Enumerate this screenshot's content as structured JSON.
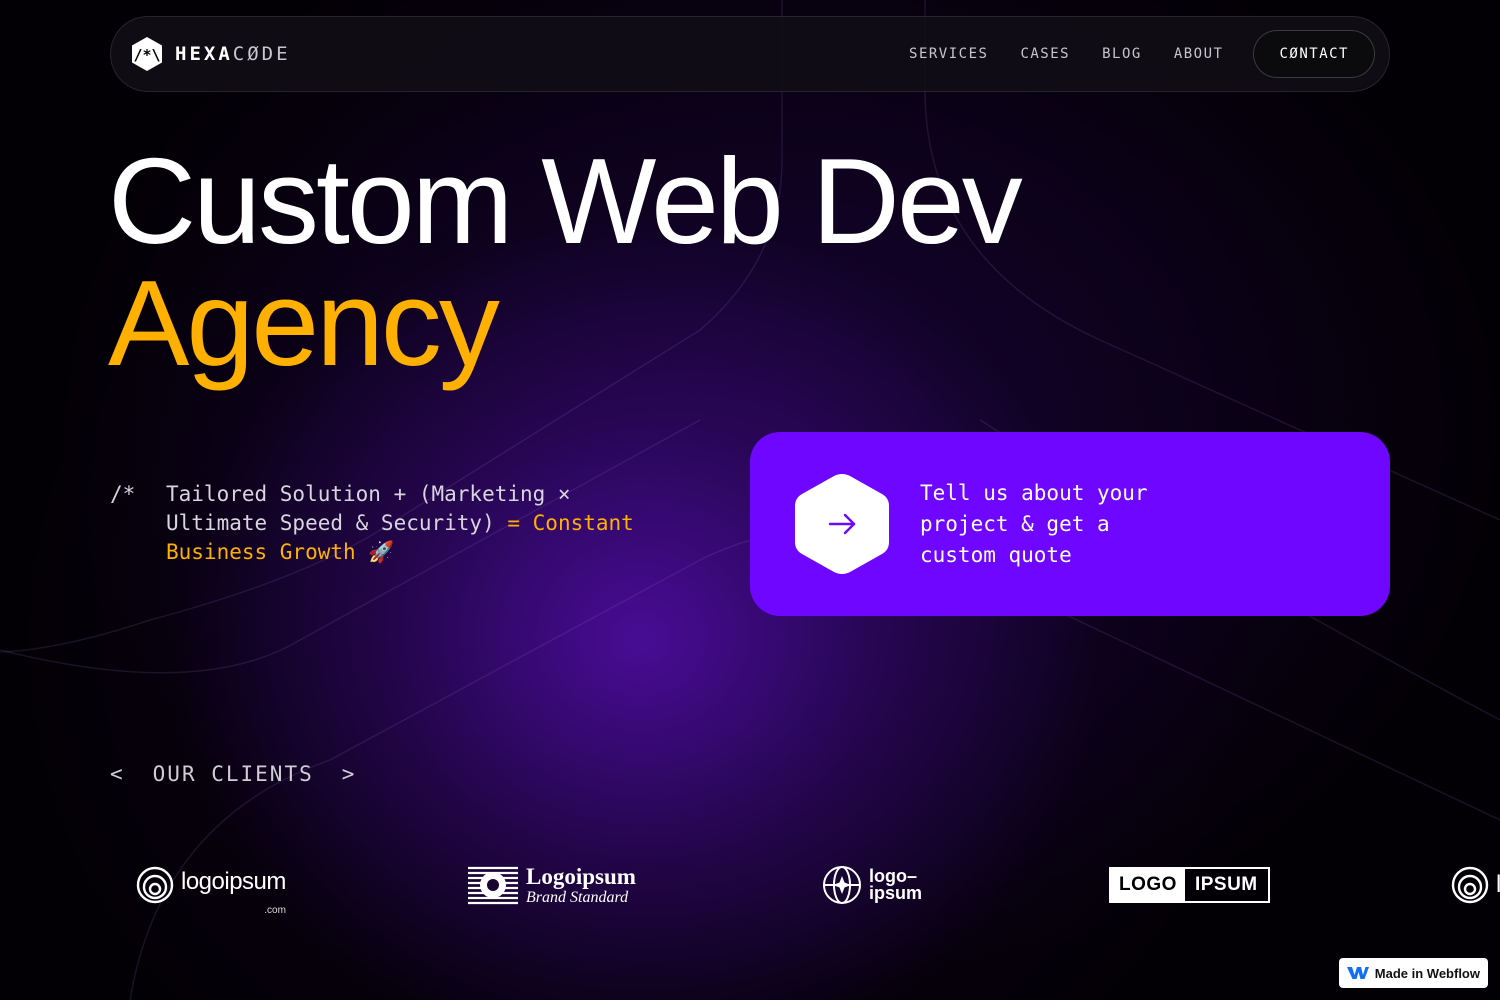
{
  "nav": {
    "brand_primary": "HEXA",
    "brand_secondary": "CØDE",
    "links": [
      "SERVICES",
      "CASES",
      "BLOG",
      "ABOUT"
    ],
    "contact_label": "CØNTACT"
  },
  "hero": {
    "line1": "Custom Web Dev",
    "line2": "Agency",
    "accent_color": "#ffb000"
  },
  "tagline": {
    "comment": "/*",
    "part1": "Tailored Solution + (Marketing × Ultimate Speed & Security) ",
    "part2": "= Constant Business Growth",
    "emoji": " 🚀"
  },
  "cta": {
    "text": "Tell us about your project & get a custom quote",
    "bg_color": "#6f06ff",
    "icon": "arrow-right-icon"
  },
  "clients": {
    "open": "<",
    "label": "OUR CLIENTS",
    "close": ">",
    "logos": [
      {
        "name": "logoipsum",
        "sub": ".com"
      },
      {
        "name": "Logoipsum",
        "sub": "Brand Standard"
      },
      {
        "name": "logo–",
        "name2": "ipsum"
      },
      {
        "name": "LOGO",
        "name2": "IPSUM"
      },
      {
        "name": "logoipsum"
      }
    ]
  },
  "badge": {
    "label": "Made in Webflow"
  }
}
